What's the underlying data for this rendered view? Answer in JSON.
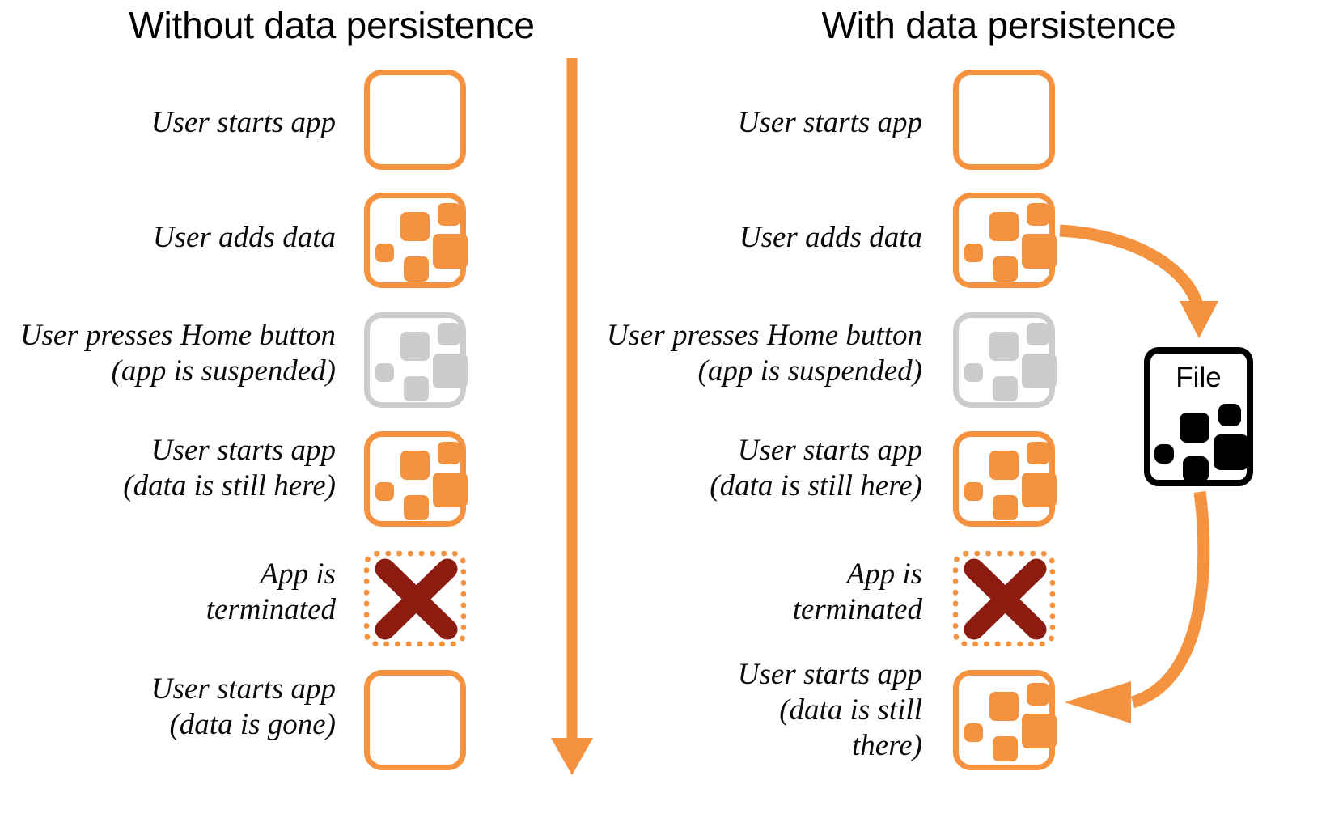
{
  "diagram": {
    "title_left": "Without data persistence",
    "title_right": "With data persistence",
    "accent_color": "#f4923f",
    "suspended_color": "#cccccc",
    "terminated_x_color": "#8c1b10",
    "file_color": "#000000"
  },
  "left_column": {
    "steps": [
      {
        "label": "User starts app",
        "state": "empty"
      },
      {
        "label": "User adds data",
        "state": "data"
      },
      {
        "label": "User presses Home button\n(app is suspended)",
        "state": "suspended"
      },
      {
        "label": "User starts app\n(data is still here)",
        "state": "data"
      },
      {
        "label": "App is\nterminated",
        "state": "terminated"
      },
      {
        "label": "User starts app\n(data is gone)",
        "state": "empty"
      }
    ]
  },
  "right_column": {
    "steps": [
      {
        "label": "User starts app",
        "state": "empty"
      },
      {
        "label": "User adds data",
        "state": "data"
      },
      {
        "label": "User presses Home button\n(app is suspended)",
        "state": "suspended"
      },
      {
        "label": "User starts app\n(data is still here)",
        "state": "data"
      },
      {
        "label": "App is\nterminated",
        "state": "terminated"
      },
      {
        "label": "User starts app\n(data is still\nthere)",
        "state": "data"
      }
    ]
  },
  "file": {
    "label": "File"
  },
  "arrows": {
    "timeline_direction": "down",
    "save_arrow": "app-to-file",
    "restore_arrow": "file-to-app"
  }
}
